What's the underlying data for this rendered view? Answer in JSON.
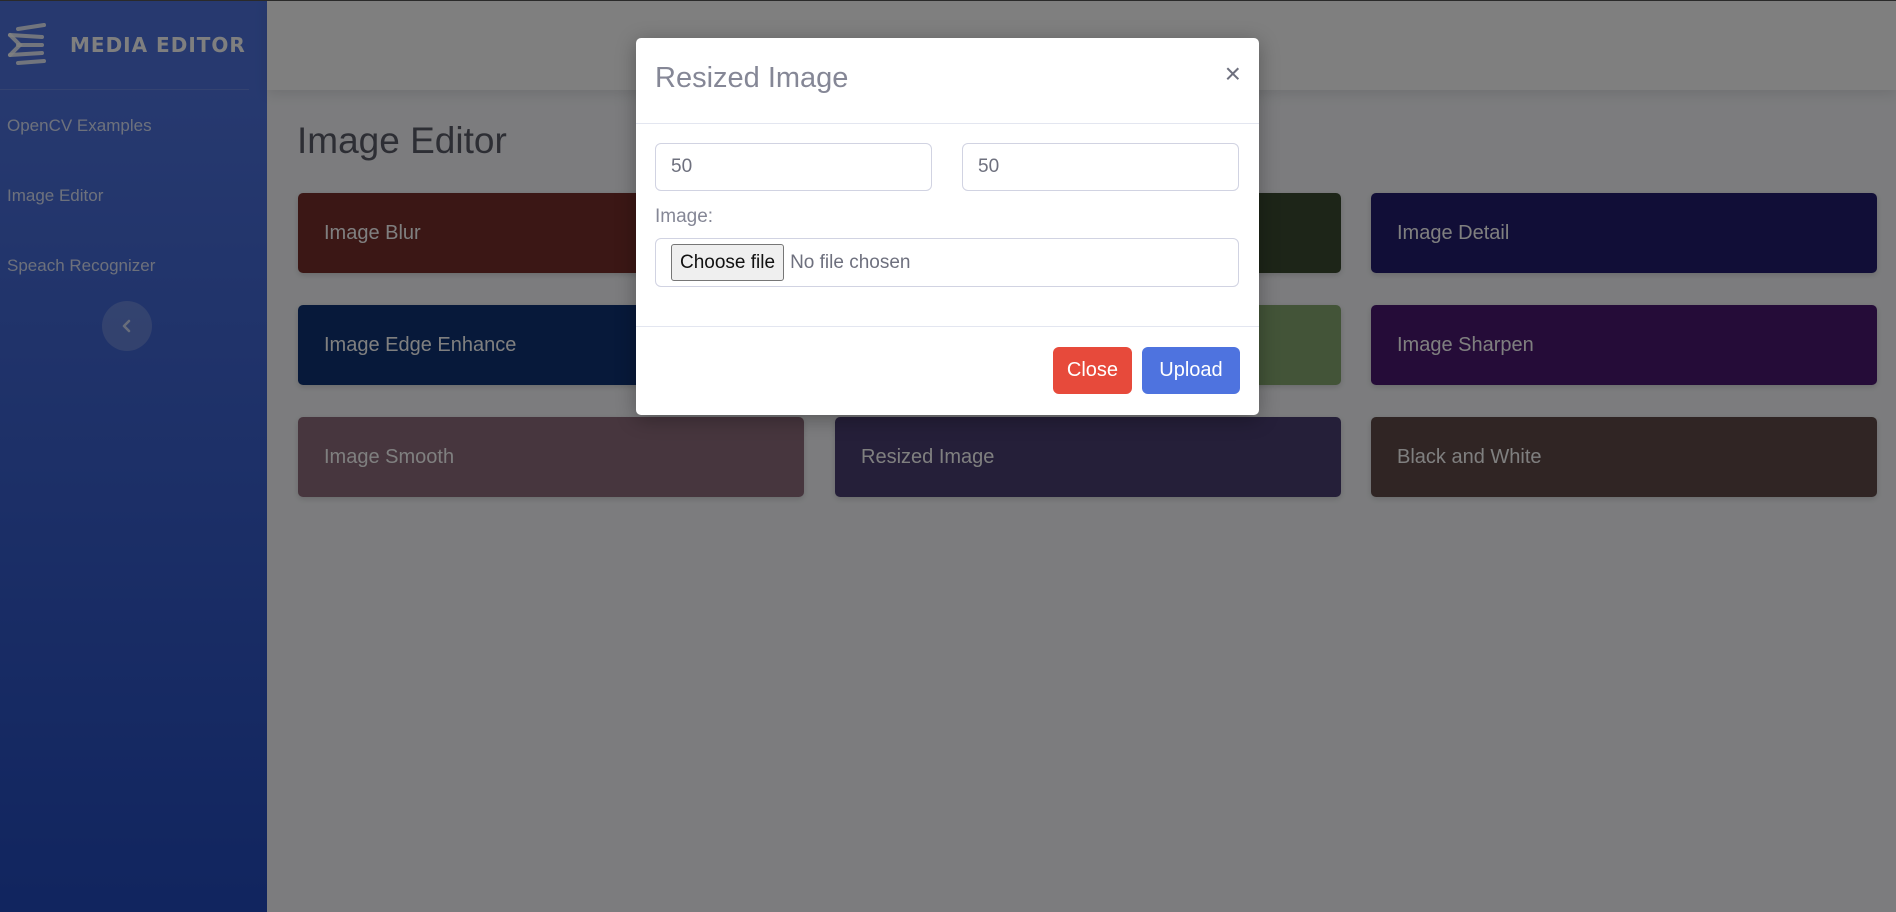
{
  "brand": {
    "name": "MEDIA EDITOR",
    "logo_icon": "brand-logo-icon"
  },
  "sidebar": {
    "items": [
      {
        "label": "OpenCV Examples"
      },
      {
        "label": "Image Editor"
      },
      {
        "label": "Speach Recognizer"
      }
    ],
    "toggle_icon": "chevron-left-icon"
  },
  "main": {
    "title": "Image Editor",
    "cards": [
      {
        "label": "Image Blur",
        "color": "#762e2a"
      },
      {
        "label": "",
        "color": "#3a4b30"
      },
      {
        "label": "Image Detail",
        "color": "#231c6e"
      },
      {
        "label": "Image Edge Enhance",
        "color": "#0e3374"
      },
      {
        "label": "",
        "color": "#86a870"
      },
      {
        "label": "Image Sharpen",
        "color": "#4b1870"
      },
      {
        "label": "Image Smooth",
        "color": "#8e6c7c"
      },
      {
        "label": "Resized Image",
        "color": "#4a3f73"
      },
      {
        "label": "Black and White",
        "color": "#614b48"
      }
    ]
  },
  "modal": {
    "title": "Resized Image",
    "close_symbol": "×",
    "width_value": "50",
    "height_value": "50",
    "image_label": "Image:",
    "file_button": "Choose file",
    "file_status": "No file chosen",
    "close_button": "Close",
    "upload_button": "Upload",
    "colors": {
      "close": "#e74a3b",
      "upload": "#4e73df"
    }
  }
}
